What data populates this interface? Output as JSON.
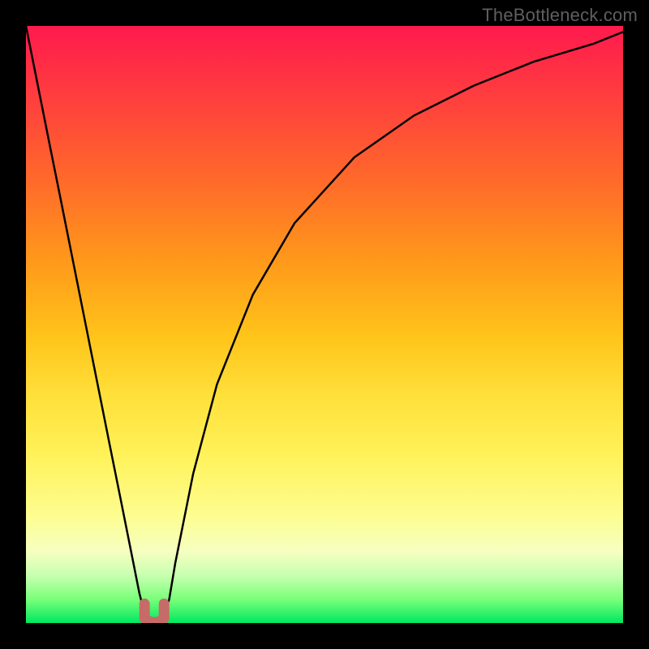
{
  "watermark": "TheBottleneck.com",
  "chart_data": {
    "type": "line",
    "title": "",
    "xlabel": "",
    "ylabel": "",
    "xlim": [
      0,
      100
    ],
    "ylim": [
      0,
      100
    ],
    "series": [
      {
        "name": "bottleneck-curve",
        "x": [
          0,
          2,
          4,
          6,
          8,
          10,
          12,
          14,
          16,
          18,
          19,
          20,
          21,
          22,
          23,
          24,
          25,
          28,
          32,
          38,
          45,
          55,
          65,
          75,
          85,
          95,
          100
        ],
        "values": [
          100,
          90,
          80,
          70,
          60,
          50,
          40,
          30,
          20,
          10,
          5,
          1,
          0,
          0,
          1,
          4,
          10,
          25,
          40,
          55,
          67,
          78,
          85,
          90,
          94,
          97,
          99
        ]
      }
    ],
    "marker": {
      "name": "optimal-point",
      "x": 21.5,
      "y": 0.5,
      "color": "#c76b68"
    },
    "background_gradient": [
      "#ff1a4d",
      "#ff6a2a",
      "#ffe03a",
      "#7aff7a",
      "#00e860"
    ]
  }
}
